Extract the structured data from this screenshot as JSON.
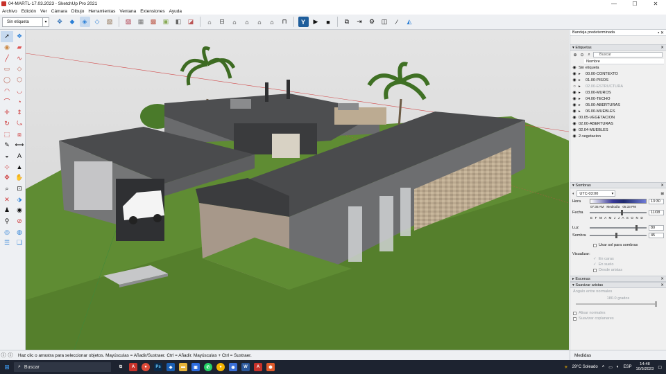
{
  "window": {
    "title": "04-MARTL-17.03.2023 - SketchUp Pro 2021",
    "minimize": "—",
    "maximize": "☐",
    "close": "✕"
  },
  "menu": [
    "Archivo",
    "Edición",
    "Ver",
    "Cámara",
    "Dibujo",
    "Herramientas",
    "Ventana",
    "Extensiones",
    "Ayuda"
  ],
  "toolbar": {
    "tag_selector": "Sin etiqueta"
  },
  "panel": {
    "title": "Bandeja predeterminada",
    "tags": {
      "section": "Etiquetas",
      "search_placeholder": "Buscar",
      "column": "Nombre",
      "items": [
        {
          "name": "Sin etiqueta",
          "indent": 0,
          "visible": true
        },
        {
          "name": "00.00-CONTEXTO",
          "indent": 1,
          "visible": true
        },
        {
          "name": "01.00-PISOS",
          "indent": 1,
          "visible": true
        },
        {
          "name": "02.00-ESTRUCTURA",
          "indent": 1,
          "visible": false
        },
        {
          "name": "03.00-MUROS",
          "indent": 1,
          "visible": true
        },
        {
          "name": "04.00-TECHO",
          "indent": 1,
          "visible": true
        },
        {
          "name": "05.00-ABERTURAS",
          "indent": 1,
          "visible": true
        },
        {
          "name": "06.00-MUEBLES",
          "indent": 1,
          "visible": true
        },
        {
          "name": "00.05-VEGETACION",
          "indent": 0,
          "visible": true
        },
        {
          "name": "02.00-ABERTURAS",
          "indent": 0,
          "visible": true
        },
        {
          "name": "02.04-MUEBLES",
          "indent": 0,
          "visible": true
        },
        {
          "name": "2-vegetacion",
          "indent": 0,
          "visible": true
        }
      ]
    },
    "shadows": {
      "section": "Sombras",
      "timezone": "UTC-03:00",
      "hora_label": "Hora",
      "time_start": "07:35 AM",
      "time_mid": "Mediodía",
      "time_end": "05:33 PM",
      "time_value": "13:30",
      "fecha_label": "Fecha",
      "months": "E F M A M J J A S O N D",
      "date_value": "11/08",
      "luz_label": "Luz",
      "luz_value": "80",
      "sombra_label": "Sombra",
      "sombra_value": "45",
      "use_sun": "Usar sol para sombras",
      "visualizar": "Visualizar:",
      "en_caras": "En caras",
      "en_suelo": "En suelo",
      "desde_aristas": "Desde aristas"
    },
    "escenas": "Escenas",
    "suavizar": {
      "section": "Suavizar aristas",
      "angle_label": "Ángulo entre normales",
      "angle_value": "180.0  grados",
      "alisar": "Alisar normales",
      "suavizar_coplanares": "Suavizar coplanares"
    }
  },
  "status": {
    "message": "Haz clic o arrastra para seleccionar objetos. Mayúsculas = Añadir/Sustraer. Ctrl = Añadir. Mayúsculas + Ctrl = Sustraer.",
    "medidas": "Medidas"
  },
  "taskbar": {
    "search": "Buscar",
    "weather": "29°C  Soleado",
    "lang": "ESP",
    "time": "14:48",
    "date": "10/5/2023"
  },
  "colors": {
    "grass": "#5e8a32",
    "sky": "#dcdcdc",
    "roof": "#4a4b4d",
    "wall": "#6e6f70",
    "stone": "#b8a78f"
  }
}
